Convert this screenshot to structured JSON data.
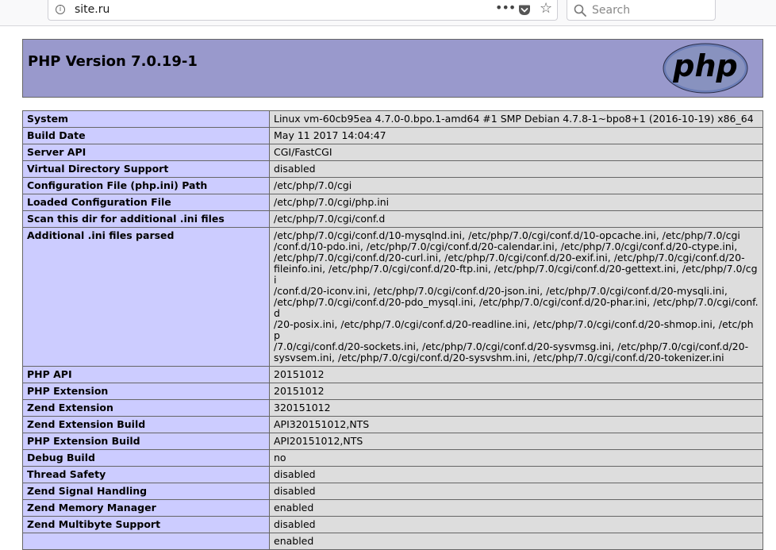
{
  "browser": {
    "url": "site.ru",
    "search_placeholder": "Search",
    "more_glyph": "•••",
    "star_glyph": "☆",
    "info_glyph": "i"
  },
  "page": {
    "title": "PHP Version 7.0.19-1",
    "logo_text": "php"
  },
  "rows": [
    {
      "label": "System",
      "value": "Linux vm-60cb95ea 4.7.0-0.bpo.1-amd64 #1 SMP Debian 4.7.8-1~bpo8+1 (2016-10-19) x86_64"
    },
    {
      "label": "Build Date",
      "value": "May 11 2017 14:04:47"
    },
    {
      "label": "Server API",
      "value": "CGI/FastCGI"
    },
    {
      "label": "Virtual Directory Support",
      "value": "disabled"
    },
    {
      "label": "Configuration File (php.ini) Path",
      "value": "/etc/php/7.0/cgi"
    },
    {
      "label": "Loaded Configuration File",
      "value": "/etc/php/7.0/cgi/php.ini"
    },
    {
      "label": "Scan this dir for additional .ini files",
      "value": "/etc/php/7.0/cgi/conf.d"
    },
    {
      "label": "Additional .ini files parsed",
      "value_lines": [
        "/etc/php/7.0/cgi/conf.d/10-mysqlnd.ini, /etc/php/7.0/cgi/conf.d/10-opcache.ini, /etc/php/7.0/cgi",
        "/conf.d/10-pdo.ini, /etc/php/7.0/cgi/conf.d/20-calendar.ini, /etc/php/7.0/cgi/conf.d/20-ctype.ini,",
        "/etc/php/7.0/cgi/conf.d/20-curl.ini, /etc/php/7.0/cgi/conf.d/20-exif.ini, /etc/php/7.0/cgi/conf.d/20-",
        "fileinfo.ini, /etc/php/7.0/cgi/conf.d/20-ftp.ini, /etc/php/7.0/cgi/conf.d/20-gettext.ini, /etc/php/7.0/cgi",
        "/conf.d/20-iconv.ini, /etc/php/7.0/cgi/conf.d/20-json.ini, /etc/php/7.0/cgi/conf.d/20-mysqli.ini,",
        "/etc/php/7.0/cgi/conf.d/20-pdo_mysql.ini, /etc/php/7.0/cgi/conf.d/20-phar.ini, /etc/php/7.0/cgi/conf.d",
        "/20-posix.ini, /etc/php/7.0/cgi/conf.d/20-readline.ini, /etc/php/7.0/cgi/conf.d/20-shmop.ini, /etc/php",
        "/7.0/cgi/conf.d/20-sockets.ini, /etc/php/7.0/cgi/conf.d/20-sysvmsg.ini, /etc/php/7.0/cgi/conf.d/20-",
        "sysvsem.ini, /etc/php/7.0/cgi/conf.d/20-sysvshm.ini, /etc/php/7.0/cgi/conf.d/20-tokenizer.ini"
      ]
    },
    {
      "label": "PHP API",
      "value": "20151012"
    },
    {
      "label": "PHP Extension",
      "value": "20151012"
    },
    {
      "label": "Zend Extension",
      "value": "320151012"
    },
    {
      "label": "Zend Extension Build",
      "value": "API320151012,NTS"
    },
    {
      "label": "PHP Extension Build",
      "value": "API20151012,NTS"
    },
    {
      "label": "Debug Build",
      "value": "no"
    },
    {
      "label": "Thread Safety",
      "value": "disabled"
    },
    {
      "label": "Zend Signal Handling",
      "value": "disabled"
    },
    {
      "label": "Zend Memory Manager",
      "value": "enabled"
    },
    {
      "label": "Zend Multibyte Support",
      "value": "disabled"
    },
    {
      "label": "",
      "value": "enabled"
    }
  ]
}
